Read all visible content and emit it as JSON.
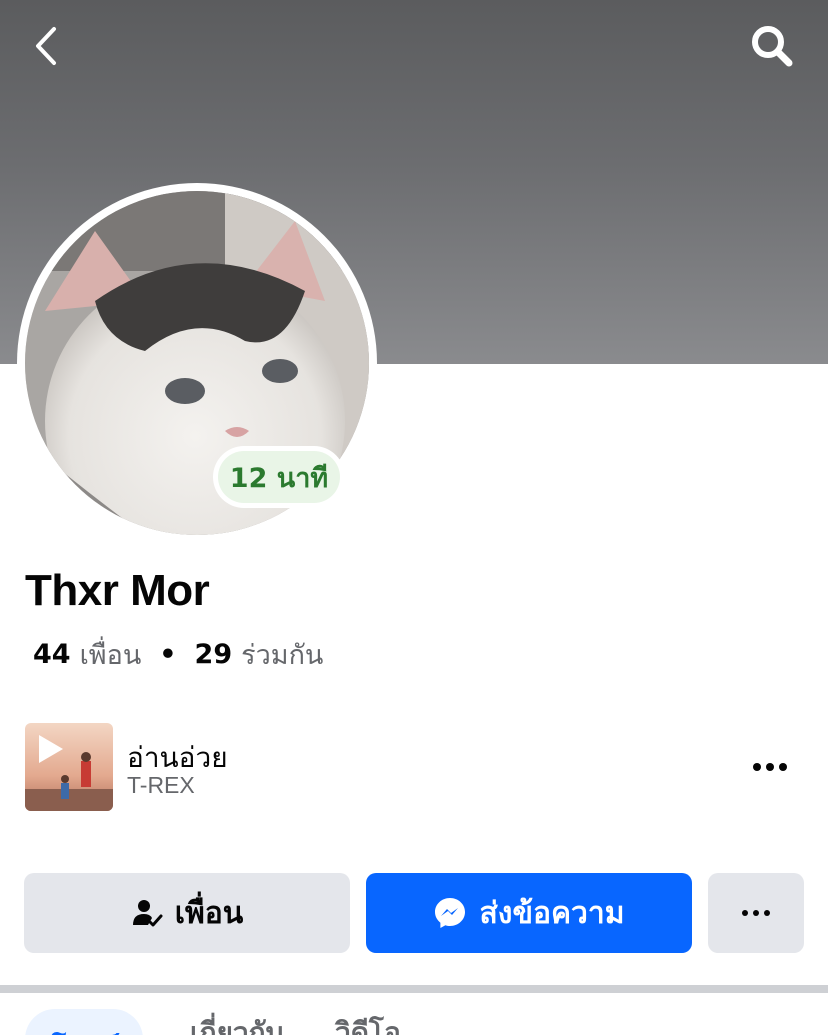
{
  "header": {
    "back_icon": "chevron-left-icon",
    "search_icon": "search-icon"
  },
  "profile": {
    "name": "Thxr Mor",
    "status_time": "12 นาที",
    "friends_count": "44",
    "friends_label": "เพื่อน",
    "mutual_count": "29",
    "mutual_label": "ร่วมกัน",
    "separator": "•"
  },
  "music": {
    "title": "อ่านอ่วย",
    "artist": "T-REX",
    "cover_icon": "play-icon",
    "more_icon": "more-horizontal-icon"
  },
  "actions": {
    "friend_label": "เพื่อน",
    "friend_icon": "friend-check-icon",
    "message_label": "ส่งข้อความ",
    "message_icon": "messenger-icon",
    "more_icon": "more-horizontal-icon"
  },
  "tabs": [
    {
      "label": "โพสต์",
      "active": true
    },
    {
      "label": "เกี่ยวกับ",
      "active": false
    },
    {
      "label": "วิดีโอ",
      "active": false
    }
  ],
  "colors": {
    "accent": "#0866ff",
    "status_green": "#2b7a2f",
    "secondary_button": "#e4e6eb",
    "muted_text": "#65676b"
  }
}
